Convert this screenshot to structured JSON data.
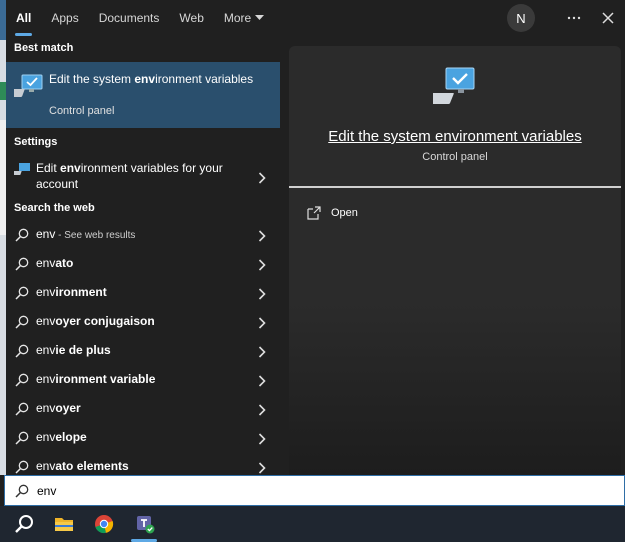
{
  "tabs": [
    {
      "label": "All",
      "active": true
    },
    {
      "label": "Apps"
    },
    {
      "label": "Documents"
    },
    {
      "label": "Web"
    },
    {
      "label": "More"
    }
  ],
  "user": {
    "initial": "N"
  },
  "sections": {
    "best_match": "Best match",
    "settings": "Settings",
    "search_web": "Search the web"
  },
  "best_match": {
    "title_pre": "Edit the system ",
    "title_bold": "env",
    "title_post": "ironment variables",
    "subtitle": "Control panel"
  },
  "setting": {
    "pre": "Edit ",
    "bold": "env",
    "post": "ironment variables for your account"
  },
  "web_results": [
    {
      "prefix": "env",
      "rest": "",
      "suffix": " - See web results"
    },
    {
      "prefix": "env",
      "rest": "ato"
    },
    {
      "prefix": "env",
      "rest": "ironment"
    },
    {
      "prefix": "env",
      "rest": "oyer conjugaison"
    },
    {
      "prefix": "env",
      "rest": "ie de plus"
    },
    {
      "prefix": "env",
      "rest": "ironment variable"
    },
    {
      "prefix": "env",
      "rest": "oyer"
    },
    {
      "prefix": "env",
      "rest": "elope"
    },
    {
      "prefix": "env",
      "rest": "ato elements"
    }
  ],
  "preview": {
    "title": "Edit the system environment variables",
    "subtitle": "Control panel",
    "action": "Open"
  },
  "search": {
    "value": "env"
  },
  "colors": {
    "accent": "#5ea9e5",
    "selected": "#2a4f6d"
  },
  "taskbar": [
    "search-icon",
    "file-explorer-icon",
    "chrome-icon",
    "teams-icon"
  ]
}
